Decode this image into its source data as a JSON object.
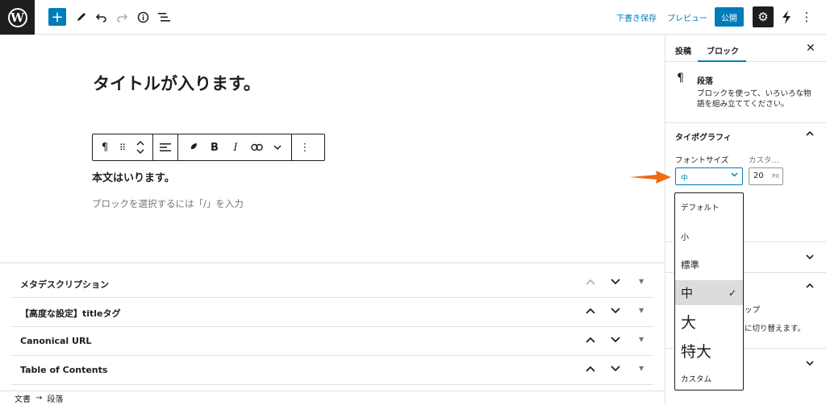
{
  "topbar": {
    "save_draft": "下書き保存",
    "preview": "プレビュー",
    "publish": "公開"
  },
  "editor": {
    "title": "タイトルが入ります。",
    "paragraph": "本文はいります。",
    "placeholder": "ブロックを選択するには「/」を入力"
  },
  "metaboxes": [
    {
      "label": "メタデスクリプション"
    },
    {
      "label": "【高度な設定】titleタグ"
    },
    {
      "label": "Canonical URL"
    },
    {
      "label": "Table of Contents"
    }
  ],
  "breadcrumb": {
    "root": "文書",
    "sep": "→",
    "current": "段落"
  },
  "sidebar": {
    "tab_post": "投稿",
    "tab_block": "ブロック",
    "block_name": "段落",
    "block_desc": "ブロックを使って、いろいろな物語を組み立ててください。",
    "typography_title": "タイポグラフィ",
    "font_size_label": "フォントサイズ",
    "custom_label": "カスタ…",
    "font_size_value": "中",
    "custom_value": "20",
    "custom_unit": "PX",
    "partial_text_1": "ップ",
    "partial_text_2": "に切り替えます。"
  },
  "font_size_options": [
    {
      "label": "デフォルト",
      "selected": false
    },
    {
      "label": "小",
      "selected": false
    },
    {
      "label": "標準",
      "selected": false
    },
    {
      "label": "中",
      "selected": true
    },
    {
      "label": "大",
      "selected": false
    },
    {
      "label": "特大",
      "selected": false
    },
    {
      "label": "カスタム",
      "selected": false
    }
  ],
  "colors": {
    "accent": "#007cba",
    "arrow": "#f26a13",
    "dark": "#1e1e1e"
  }
}
